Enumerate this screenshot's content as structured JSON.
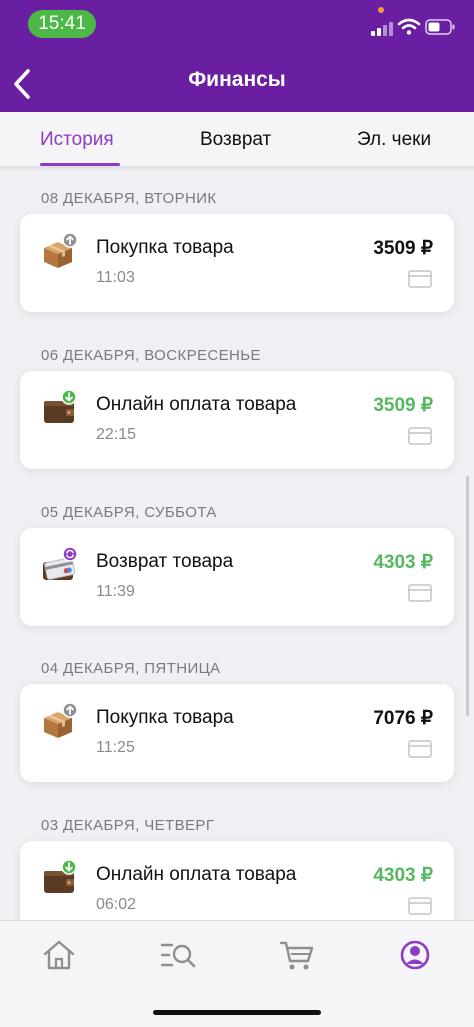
{
  "status_bar": {
    "time": "15:41"
  },
  "header": {
    "title": "Финансы",
    "back_icon": "chevron-left-icon"
  },
  "tabs": [
    {
      "label": "История",
      "active": true
    },
    {
      "label": "Возврат",
      "active": false
    },
    {
      "label": "Эл. чеки",
      "active": false
    }
  ],
  "days": [
    {
      "date": "08 ДЕКАБРЯ, ВТОРНИК",
      "item": {
        "icon": "parcel-upload-icon",
        "title": "Покупка товара",
        "time": "11:03",
        "amount": "3509 ₽",
        "amount_color": "#111111"
      }
    },
    {
      "date": "06 ДЕКАБРЯ, ВОСКРЕСЕНЬЕ",
      "item": {
        "icon": "wallet-download-icon",
        "title": "Онлайн оплата товара",
        "time": "22:15",
        "amount": "3509 ₽",
        "amount_color": "#55b861"
      }
    },
    {
      "date": "05 ДЕКАБРЯ, СУББОТА",
      "item": {
        "icon": "wallet-refund-icon",
        "title": "Возврат товара",
        "time": "11:39",
        "amount": "4303 ₽",
        "amount_color": "#55b861"
      }
    },
    {
      "date": "04 ДЕКАБРЯ, ПЯТНИЦА",
      "item": {
        "icon": "parcel-upload-icon",
        "title": "Покупка товара",
        "time": "11:25",
        "amount": "7076 ₽",
        "amount_color": "#111111"
      }
    },
    {
      "date": "03 ДЕКАБРЯ, ЧЕТВЕРГ",
      "item": {
        "icon": "wallet-download-icon",
        "title": "Онлайн оплата товара",
        "time": "06:02",
        "amount": "4303 ₽",
        "amount_color": "#55b861"
      }
    }
  ],
  "bottom_nav": [
    {
      "icon": "home-icon",
      "active": false
    },
    {
      "icon": "catalog-search-icon",
      "active": false
    },
    {
      "icon": "cart-icon",
      "active": false
    },
    {
      "icon": "profile-icon",
      "active": true
    }
  ],
  "colors": {
    "brand": "#6a1fa3",
    "accent": "#8f3bc4",
    "positive": "#55b861",
    "status_pill": "#4cb848"
  }
}
